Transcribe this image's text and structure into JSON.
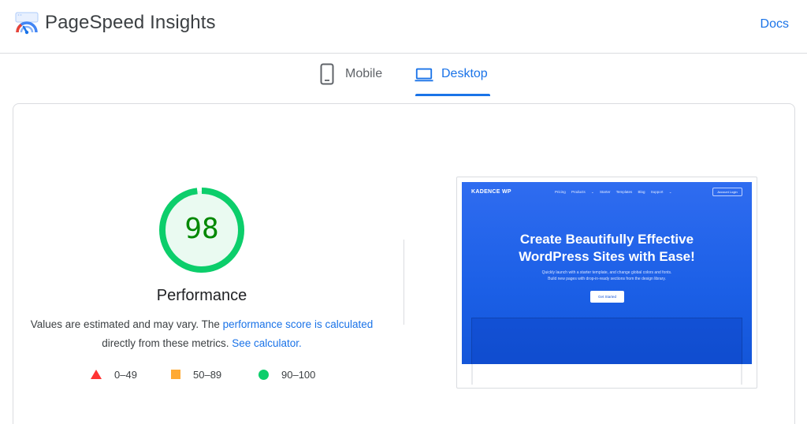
{
  "header": {
    "title": "PageSpeed Insights",
    "docs_label": "Docs"
  },
  "tabs": [
    {
      "label": "Mobile",
      "icon": "phone-icon",
      "selected": false
    },
    {
      "label": "Desktop",
      "icon": "laptop-icon",
      "selected": true
    }
  ],
  "score": {
    "value": "98",
    "fraction": 0.98,
    "label": "Performance",
    "color": "#0cce6b"
  },
  "description": {
    "text_before": "Values are estimated and may vary. The ",
    "link1": "performance score is calculated",
    "text_middle": " directly from these metrics. ",
    "link2": "See calculator."
  },
  "legend": [
    {
      "shape": "triangle",
      "range": "0–49",
      "color": "#ff3333"
    },
    {
      "shape": "square",
      "range": "50–89",
      "color": "#ffaa33"
    },
    {
      "shape": "circle",
      "range": "90–100",
      "color": "#0cce6b"
    }
  ],
  "thumbnail": {
    "logo": "KADENCE WP",
    "menu": "Pricing  Products ⌄  Starter Templates  Blog  Support ⌄",
    "login": "Account Login",
    "headline_line1": "Create Beautifully Effective",
    "headline_line2": "WordPress Sites with Ease!",
    "sub_line1": "Quickly launch with a starter template, and change global colors and fonts.",
    "sub_line2": "Build new pages with drop-in-ready sections from the design library.",
    "cta": "Get Started"
  }
}
